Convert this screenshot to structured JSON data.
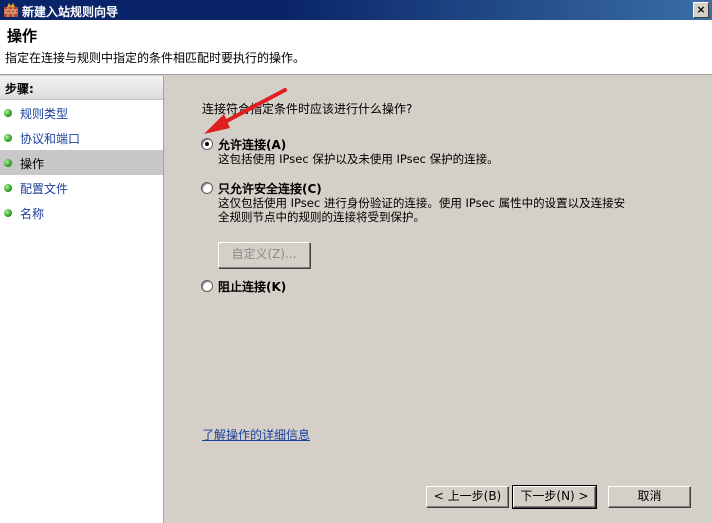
{
  "window": {
    "title": "新建入站规则向导",
    "close_label": "×"
  },
  "header": {
    "title": "操作",
    "description": "指定在连接与规则中指定的条件相匹配时要执行的操作。"
  },
  "sidebar": {
    "steps_label": "步骤:",
    "items": [
      {
        "label": "规则类型",
        "active": false
      },
      {
        "label": "协议和端口",
        "active": false
      },
      {
        "label": "操作",
        "active": true
      },
      {
        "label": "配置文件",
        "active": false
      },
      {
        "label": "名称",
        "active": false
      }
    ]
  },
  "main": {
    "question": "连接符合指定条件时应该进行什么操作?",
    "options": [
      {
        "label": "允许连接(A)",
        "desc_line1": "这包括使用 IPsec 保护以及未使用 IPsec 保护的连接。",
        "desc_line2": "",
        "checked": true
      },
      {
        "label": "只允许安全连接(C)",
        "desc_line1": "这仅包括使用 IPsec 进行身份验证的连接。使用 IPsec 属性中的设置以及连接安",
        "desc_line2": "全规则节点中的规则的连接将受到保护。",
        "checked": false
      },
      {
        "label": "阻止连接(K)",
        "desc_line1": "",
        "desc_line2": "",
        "checked": false
      }
    ],
    "customize_label": "自定义(Z)...",
    "learn_more_link": "了解操作的详细信息"
  },
  "footer": {
    "back_label": "< 上一步(B)",
    "next_label": "下一步(N) >",
    "cancel_label": "取消"
  },
  "colors": {
    "titlebar": "#0a246a",
    "link": "#1a3f9c",
    "annotation_arrow": "#e02020"
  }
}
